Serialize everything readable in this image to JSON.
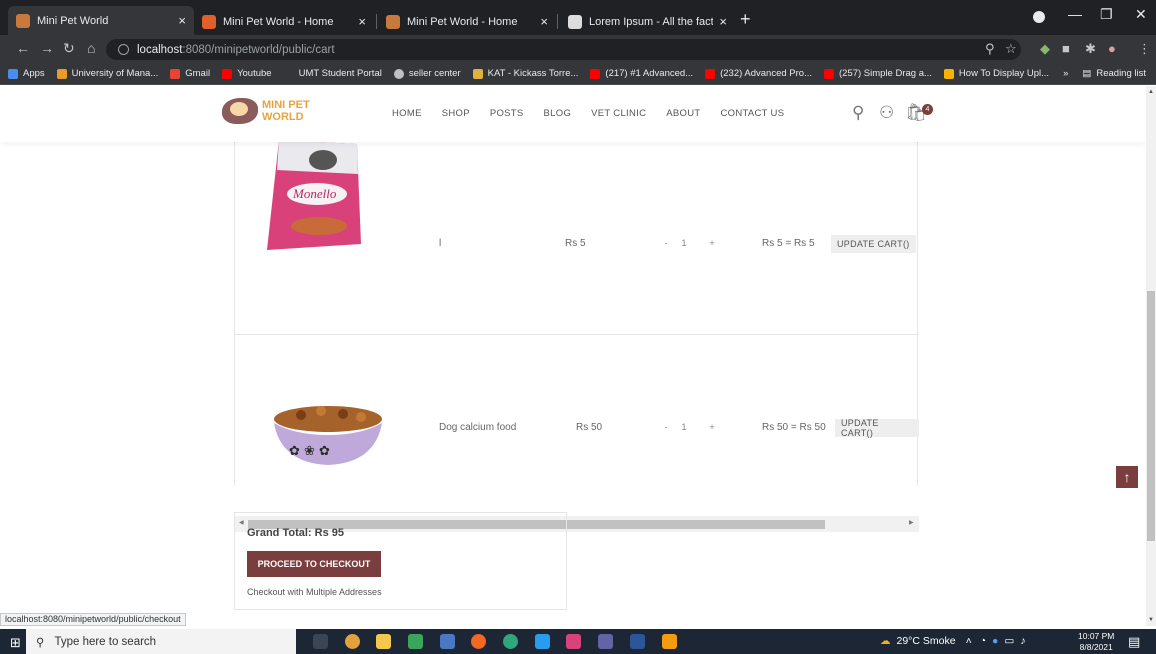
{
  "browser": {
    "tabs": [
      {
        "title": "Mini Pet World",
        "favicon_color": "#c87a3c"
      },
      {
        "title": "Mini Pet World - Home",
        "favicon_color": "#e0602b"
      },
      {
        "title": "Mini Pet World - Home",
        "favicon_color": "#c87a3c"
      },
      {
        "title": "Lorem Ipsum - All the facts - Lips",
        "favicon_color": "#dcdcdc"
      }
    ],
    "new_tab": "+",
    "url_host": "localhost",
    "url_path": ":8080/minipetworld/public/cart",
    "bookmarks": [
      {
        "label": "Apps",
        "color": "#4a8df0"
      },
      {
        "label": "University of Mana...",
        "color": "#e89b2a"
      },
      {
        "label": "Gmail",
        "color": "#ea4335"
      },
      {
        "label": "Youtube",
        "color": "#ff0000"
      },
      {
        "label": "UMT Student Portal",
        "color": "#35363a"
      },
      {
        "label": "seller center",
        "color": "#bdc1c6"
      },
      {
        "label": "KAT - Kickass Torre...",
        "color": "#e0b13c"
      },
      {
        "label": "(217) #1 Advanced...",
        "color": "#ff0000"
      },
      {
        "label": "(232) Advanced Pro...",
        "color": "#ff0000"
      },
      {
        "label": "(257) Simple Drag a...",
        "color": "#ff0000"
      },
      {
        "label": "How To Display Upl...",
        "color": "#f4b400"
      }
    ],
    "bookmarks_more": "»",
    "reading_list": "Reading list",
    "status_url": "localhost:8080/minipetworld/public/checkout"
  },
  "site": {
    "logo_line1": "MINI PET",
    "logo_line2": "WORLD",
    "nav": [
      "HOME",
      "SHOP",
      "POSTS",
      "BLOG",
      "VET CLINIC",
      "ABOUT",
      "CONTACT US"
    ],
    "cart_count": "4",
    "accent": "#7a3e3e"
  },
  "cart": {
    "items": [
      {
        "name": "l",
        "price": "Rs 5",
        "qty": "1",
        "subtotal": "Rs 5 = Rs 5",
        "update_label": "UPDATE CART()"
      },
      {
        "name": "Dog calcium food",
        "price": "Rs 50",
        "qty": "1",
        "subtotal": "Rs 50 = Rs 50",
        "update_label": "UPDATE CART()"
      }
    ],
    "minus": "-",
    "plus": "+"
  },
  "totals": {
    "grand_total": "Grand Total: Rs 95",
    "checkout_label": "PROCEED TO CHECKOUT",
    "multi_address": "Checkout with Multiple Addresses"
  },
  "taskbar": {
    "search_placeholder": "Type here to search",
    "weather": "29°C Smoke",
    "time": "10:07 PM",
    "date": "8/8/2021"
  }
}
